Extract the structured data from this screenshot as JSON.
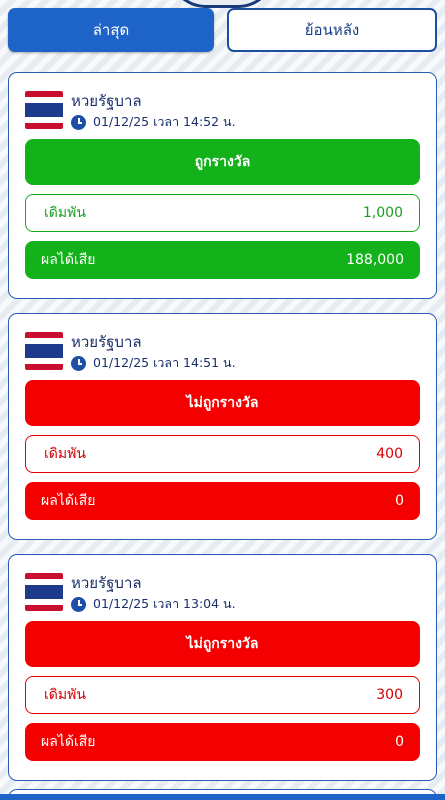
{
  "tabs": {
    "latest_label": "ล่าสุด",
    "history_label": "ย้อนหลัง"
  },
  "cards": [
    {
      "result": "win",
      "lottery_name": "หวยรัฐบาล",
      "datetime": "01/12/25 เวลา 14:52 น.",
      "status_label": "ถูกรางวัล",
      "bet_label": "เดิมพัน",
      "bet_value": "1,000",
      "result_label": "ผลได้เสีย",
      "result_value": "188,000"
    },
    {
      "result": "lose",
      "lottery_name": "หวยรัฐบาล",
      "datetime": "01/12/25 เวลา 14:51 น.",
      "status_label": "ไม่ถูกรางวัล",
      "bet_label": "เดิมพัน",
      "bet_value": "400",
      "result_label": "ผลได้เสีย",
      "result_value": "0"
    },
    {
      "result": "lose",
      "lottery_name": "หวยรัฐบาล",
      "datetime": "01/12/25 เวลา 13:04 น.",
      "status_label": "ไม่ถูกรางวัล",
      "bet_label": "เดิมพัน",
      "bet_value": "300",
      "result_label": "ผลได้เสีย",
      "result_value": "0"
    }
  ],
  "icons": {
    "flag": "thailand-flag-icon",
    "clock": "clock-icon"
  },
  "colors": {
    "primary": "#1e63c8",
    "win": "#13b21b",
    "lose": "#f40000"
  }
}
